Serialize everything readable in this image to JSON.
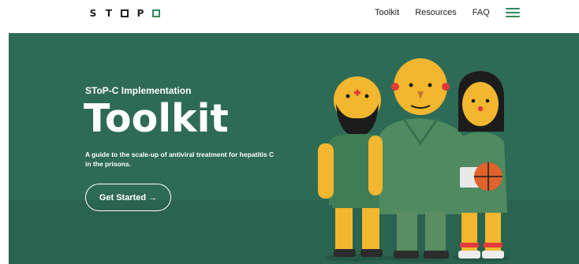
{
  "brand": {
    "name": "STOP C"
  },
  "nav": {
    "items": [
      {
        "label": "Toolkit"
      },
      {
        "label": "Resources"
      },
      {
        "label": "FAQ"
      }
    ],
    "menu_icon": "hamburger-menu-icon"
  },
  "hero": {
    "subtitle": "SToP-C Implementation",
    "title": "Toolkit",
    "description": "A guide to the scale-up of antiviral treatment for hepatitis C in the prisons.",
    "cta_label": "Get Started →",
    "colors": {
      "background": "#2e6b56",
      "accent": "#2f8a5f",
      "text": "#ffffff"
    }
  }
}
